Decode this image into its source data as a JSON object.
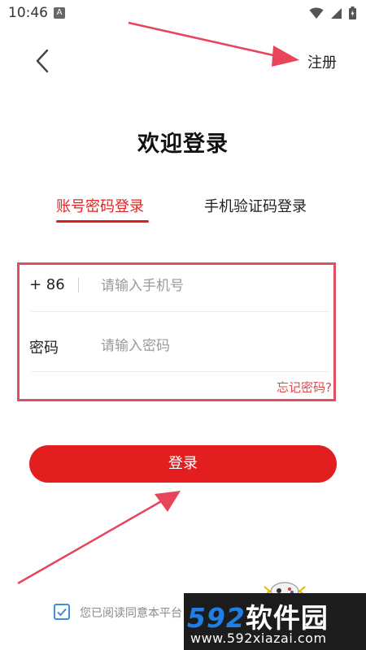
{
  "status_bar": {
    "time": "10:46",
    "notification_badge": "A",
    "icons": [
      "wifi-icon",
      "signal-icon",
      "battery-icon"
    ]
  },
  "header": {
    "back_icon": "chevron-left-icon",
    "register_label": "注册"
  },
  "page_title": "欢迎登录",
  "tabs": [
    {
      "label": "账号密码登录",
      "active": true
    },
    {
      "label": "手机验证码登录",
      "active": false
    }
  ],
  "form": {
    "country_code": "+ 86",
    "phone_placeholder": "请输入手机号",
    "password_label": "密码",
    "password_placeholder": "请输入密码",
    "forgot_link": "忘记密码?"
  },
  "login_button": "登录",
  "agreement": {
    "checked": true,
    "text": "您已阅读同意本平台"
  },
  "watermark": {
    "number": "592",
    "name": "软件园",
    "url": "www.592xiazai.com"
  },
  "colors": {
    "accent": "#e31e1e",
    "tab_active": "#e02424",
    "highlight_box": "#e0505f",
    "checkbox": "#3f8be8"
  }
}
